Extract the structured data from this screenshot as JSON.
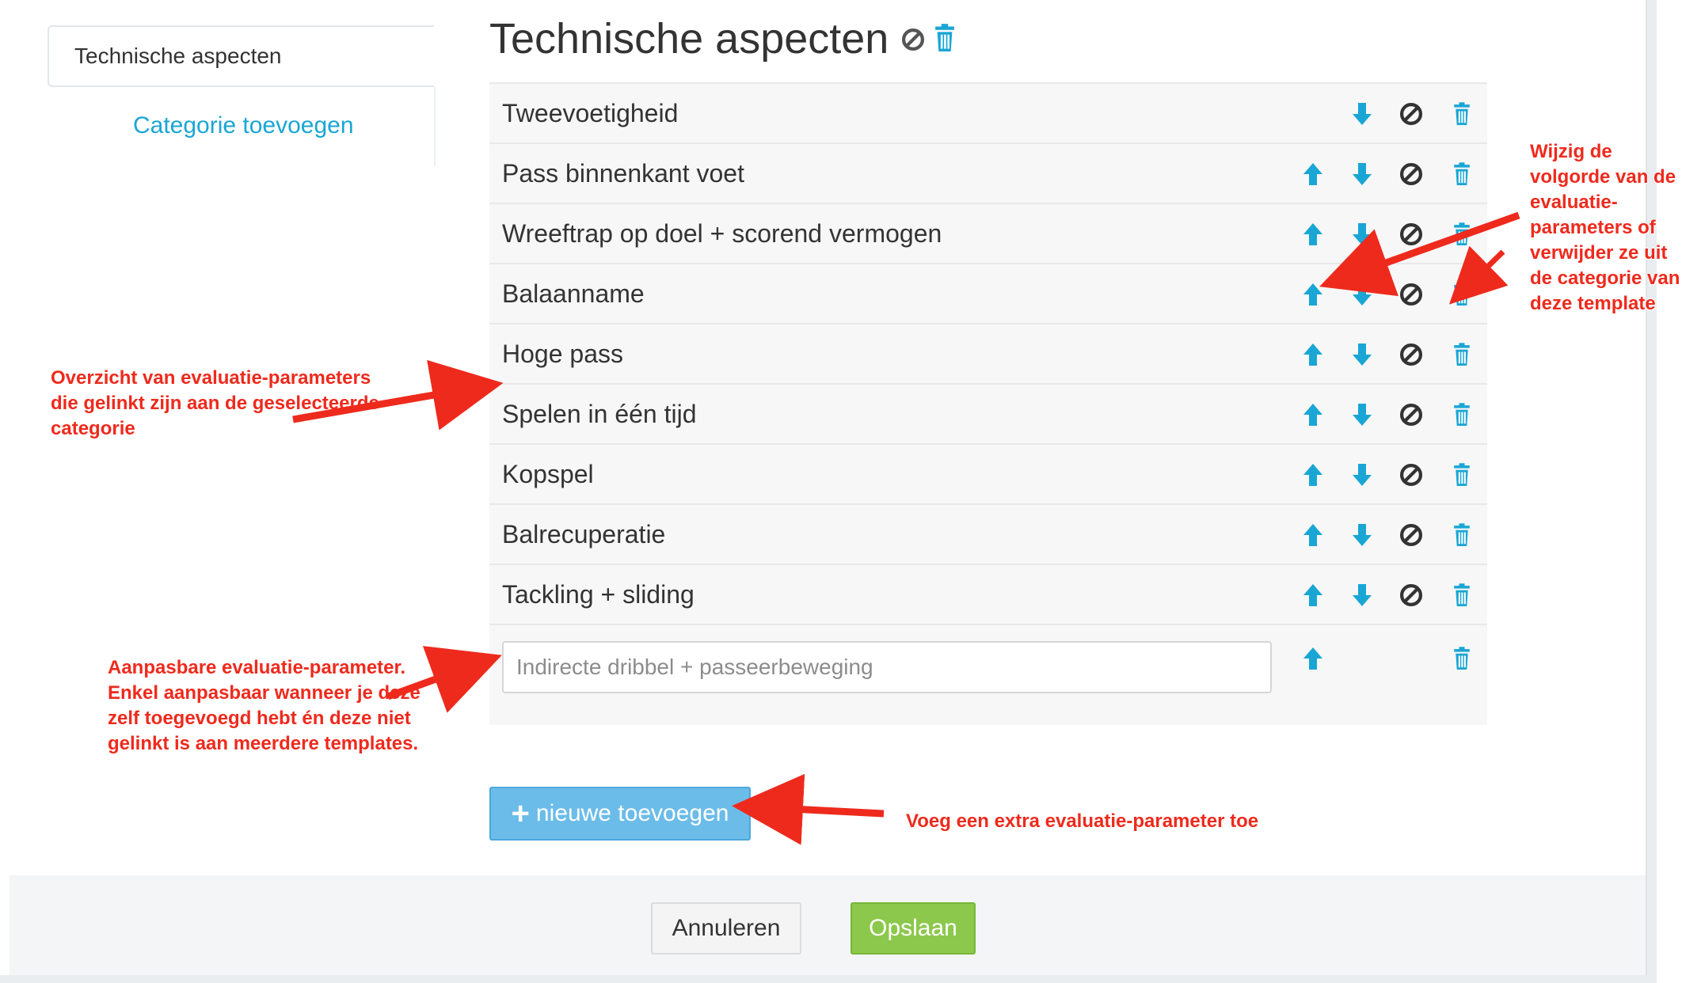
{
  "sidebar": {
    "category": "Technische aspecten",
    "add_category": "Categorie toevoegen"
  },
  "main": {
    "title": "Technische aspecten",
    "parameters": [
      {
        "label": "Tweevoetigheid",
        "can_up": false,
        "can_down": true
      },
      {
        "label": "Pass binnenkant voet",
        "can_up": true,
        "can_down": true
      },
      {
        "label": "Wreeftrap op doel + scorend vermogen",
        "can_up": true,
        "can_down": true
      },
      {
        "label": "Balaanname",
        "can_up": true,
        "can_down": true
      },
      {
        "label": "Hoge pass",
        "can_up": true,
        "can_down": true
      },
      {
        "label": "Spelen in één tijd",
        "can_up": true,
        "can_down": true
      },
      {
        "label": "Kopspel",
        "can_up": true,
        "can_down": true
      },
      {
        "label": "Balrecuperatie",
        "can_up": true,
        "can_down": true
      },
      {
        "label": "Tackling + sliding",
        "can_up": true,
        "can_down": true
      }
    ],
    "editable_parameter": {
      "value": "",
      "placeholder": "Indirecte dribbel + passeerbeweging"
    },
    "add_new": "nieuwe toevoegen"
  },
  "footer": {
    "cancel": "Annuleren",
    "save": "Opslaan"
  },
  "annotations": {
    "reorder": "Wijzig de volgorde van de evaluatie-parameters of verwijder ze uit de categorie van deze template",
    "overview": "Overzicht van evaluatie-parameters die gelinkt zijn aan de geselecteerde categorie",
    "editable": "Aanpasbare evaluatie-parameter. Enkel aanpasbaar wanneer je deze zelf toegevoegd hebt én deze niet gelinkt is aan meerdere templates.",
    "add_extra": "Voeg een extra evaluatie-parameter toe"
  },
  "colors": {
    "accent": "#19a6d4",
    "icon_dark": "#333333",
    "primary_button": "#6bbce9",
    "save_button": "#8cc84b",
    "annotation": "#ee2a1d"
  },
  "icons": {
    "up": "arrow-up-icon",
    "down": "arrow-down-icon",
    "disable": "ban-icon",
    "delete": "trash-icon"
  }
}
